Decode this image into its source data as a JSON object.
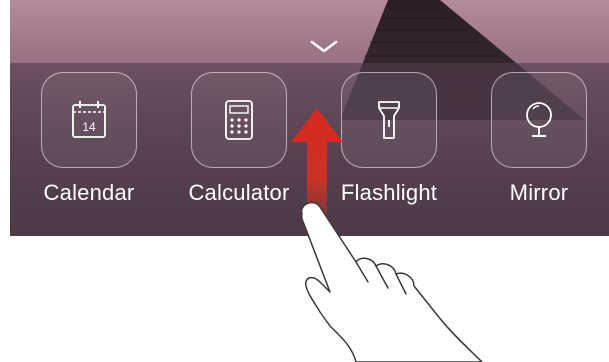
{
  "shortcuts": [
    {
      "label": "Calendar",
      "icon": "calendar-icon",
      "day": "14"
    },
    {
      "label": "Calculator",
      "icon": "calculator-icon"
    },
    {
      "label": "Flashlight",
      "icon": "flashlight-icon"
    },
    {
      "label": "Mirror",
      "icon": "mirror-icon"
    }
  ],
  "gesture": {
    "direction": "swipe-up",
    "arrow_color": "#d9281f"
  }
}
